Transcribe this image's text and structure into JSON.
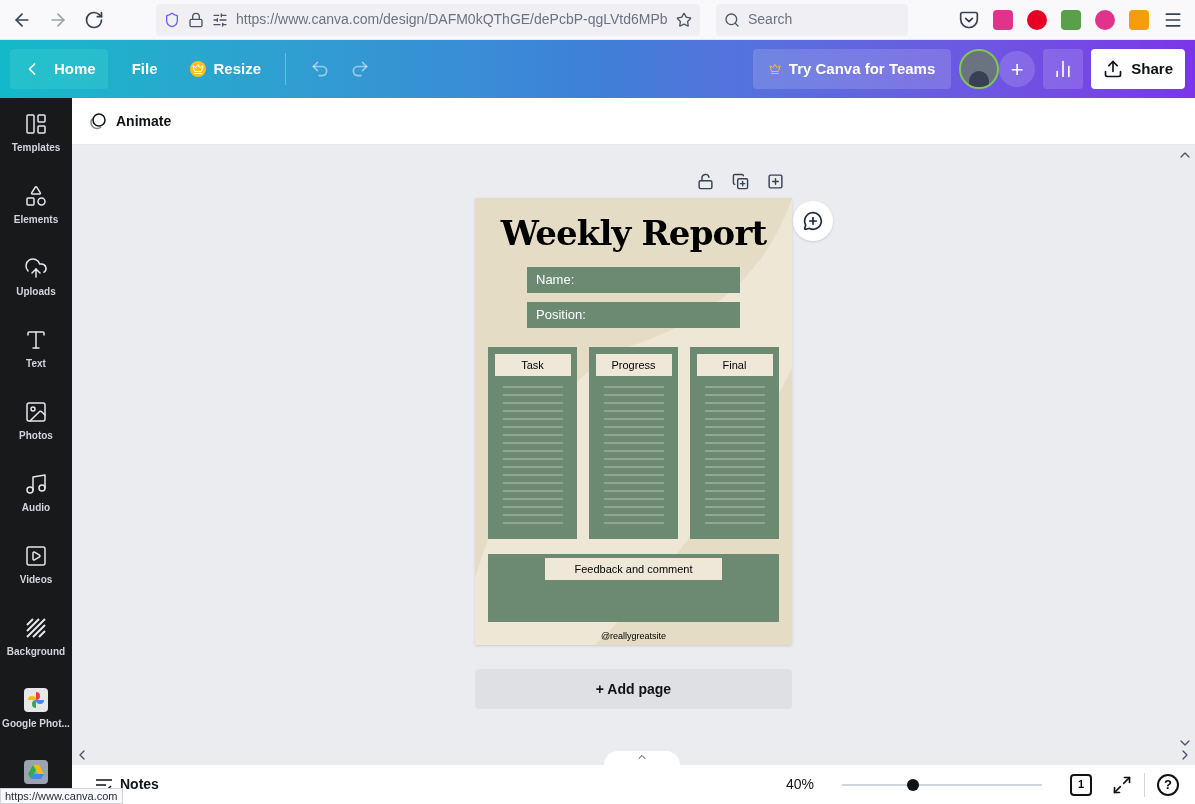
{
  "browser": {
    "url": "https://www.canva.com/design/DAFM0kQThGE/dePcbP-qgLVtd6MPb",
    "search": {
      "placeholder": "Search"
    }
  },
  "header": {
    "home": "Home",
    "file": "File",
    "resize": "Resize",
    "teams": "Try Canva for Teams",
    "share": "Share",
    "add": "+"
  },
  "sidebar": {
    "items": [
      {
        "label": "Templates",
        "kind": "templates"
      },
      {
        "label": "Elements",
        "kind": "elements"
      },
      {
        "label": "Uploads",
        "kind": "uploads"
      },
      {
        "label": "Text",
        "kind": "text"
      },
      {
        "label": "Photos",
        "kind": "photos"
      },
      {
        "label": "Audio",
        "kind": "audio"
      },
      {
        "label": "Videos",
        "kind": "videos"
      },
      {
        "label": "Background",
        "kind": "background"
      },
      {
        "label": "Google Phot...",
        "kind": "gphotos"
      },
      {
        "kind": "drive"
      }
    ]
  },
  "toolbar": {
    "animate": "Animate"
  },
  "design": {
    "title": "Weekly Report",
    "fields": [
      "Name:",
      "Position:"
    ],
    "columns": [
      "Task",
      "Progress",
      "Final"
    ],
    "feedback": "Feedback and comment",
    "footer": "@reallygreatsite"
  },
  "add_page": "+ Add page",
  "bottom_bar": {
    "notes": "Notes",
    "zoom": {
      "reading": "40%",
      "level": 0.355
    },
    "page_count": "1",
    "help": "?"
  },
  "status": "https://www.canva.com"
}
